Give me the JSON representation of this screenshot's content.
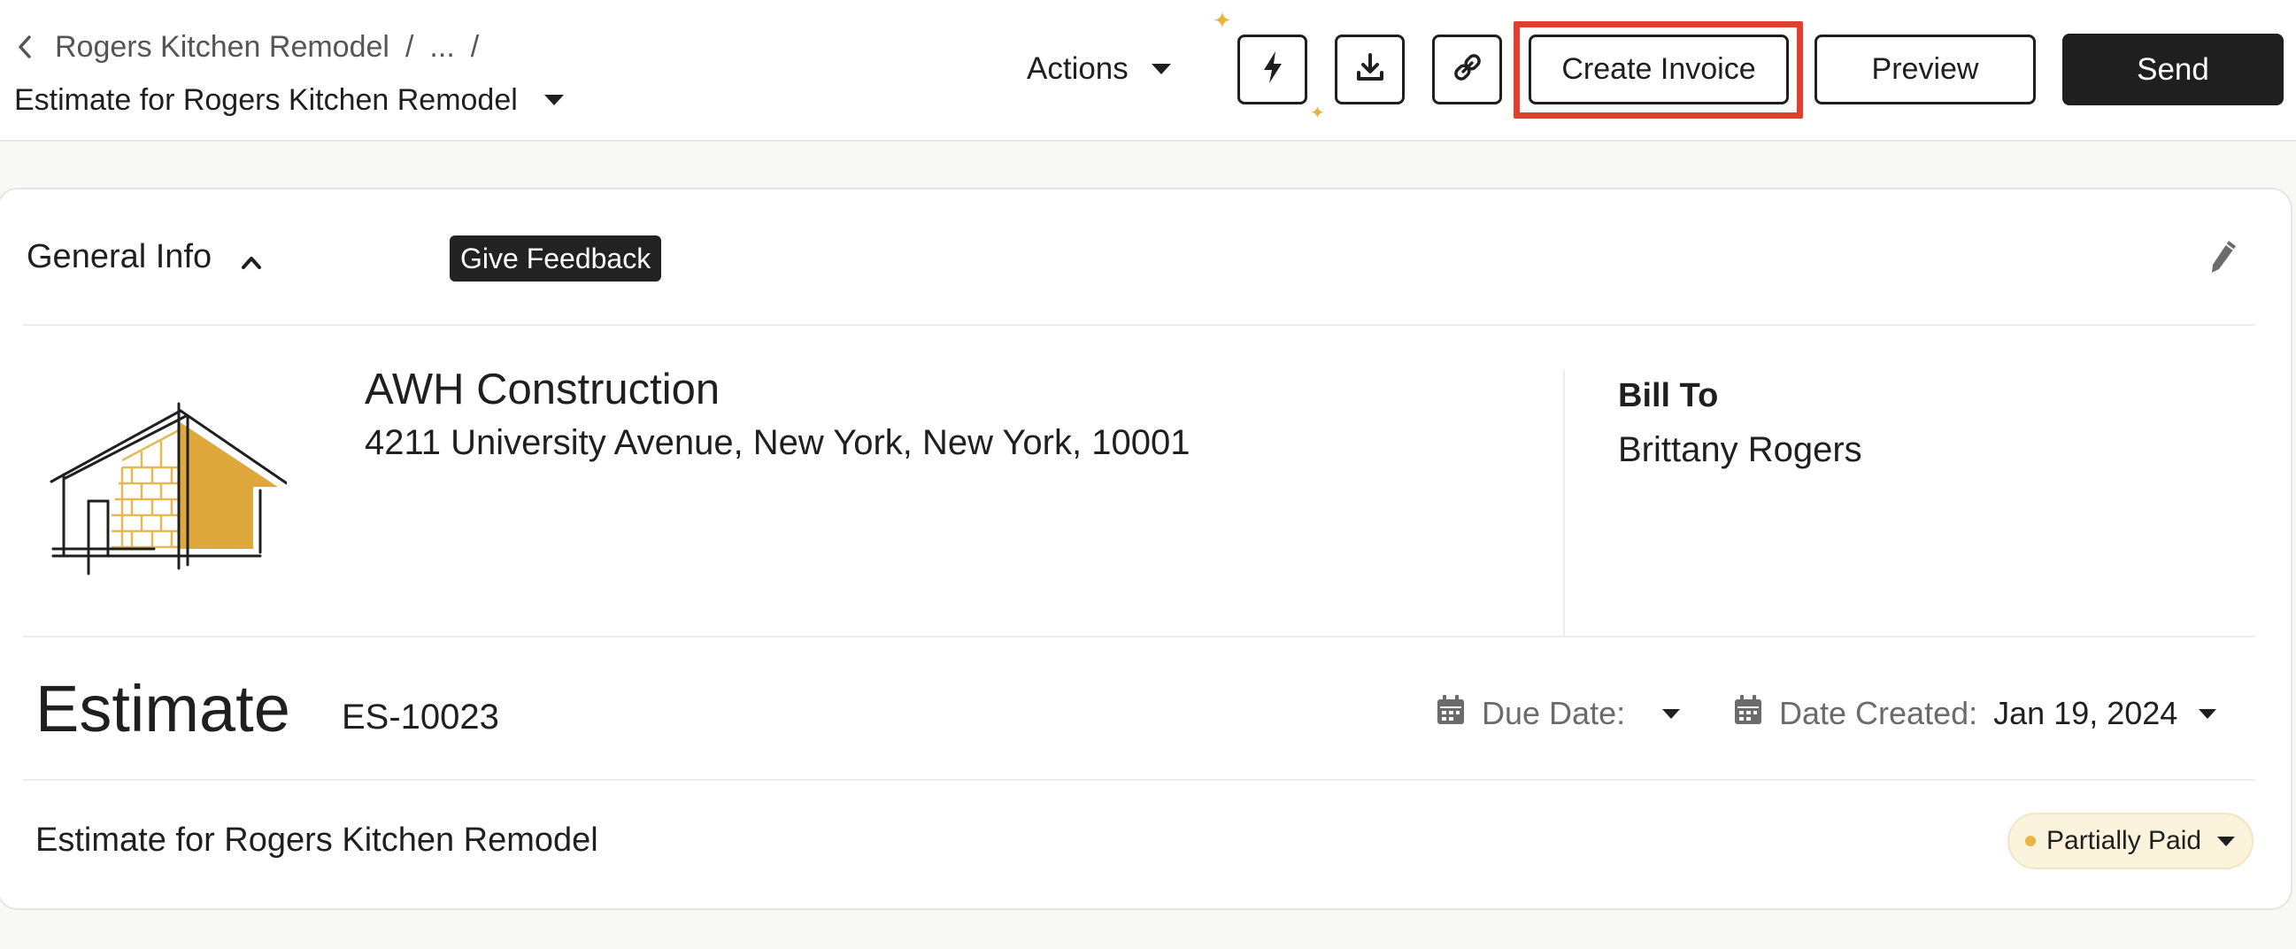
{
  "header": {
    "breadcrumb": {
      "project": "Rogers Kitchen Remodel",
      "ellipsis": "...",
      "separator": "/"
    },
    "page_title": "Estimate for Rogers Kitchen Remodel",
    "actions_label": "Actions",
    "buttons": {
      "automation_icon": "lightning-icon",
      "download_icon": "download-icon",
      "link_icon": "link-icon",
      "create_invoice": "Create Invoice",
      "preview": "Preview",
      "send": "Send"
    },
    "highlight_color": "#e0412e"
  },
  "general_info": {
    "section_title": "General Info",
    "feedback_label": "Give Feedback",
    "company": {
      "name": "AWH Construction",
      "address": "4211 University Avenue, New York, New York, 10001",
      "logo_colors": {
        "accent": "#dfa83c",
        "line": "#1f1f1f"
      }
    },
    "bill_to": {
      "label": "Bill To",
      "name": "Brittany Rogers"
    }
  },
  "document": {
    "type": "Estimate",
    "number": "ES-10023",
    "due_date": {
      "label": "Due Date:",
      "value": ""
    },
    "date_created": {
      "label": "Date Created:",
      "value": "Jan 19, 2024"
    },
    "title": "Estimate for Rogers Kitchen Remodel",
    "status": {
      "label": "Partially Paid",
      "color": "#e9b53f"
    }
  }
}
